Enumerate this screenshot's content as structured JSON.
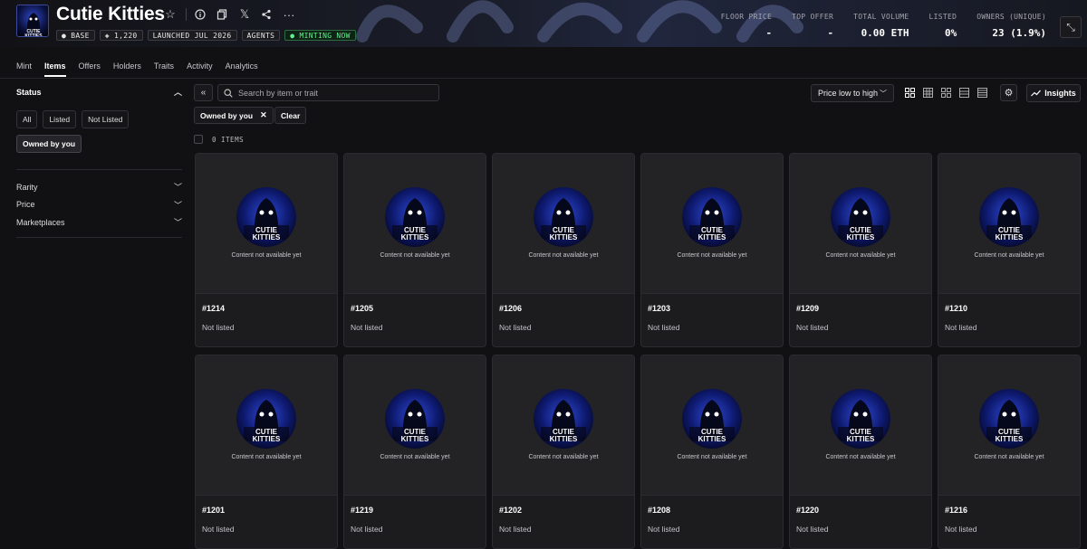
{
  "collection": {
    "name": "Cutie Kitties",
    "logo_text": "CUTIE KITTIES",
    "badges": [
      {
        "label": "BASE",
        "icon": "base-chain-icon"
      },
      {
        "label": "1,220",
        "icon": "items-icon"
      },
      {
        "label": "LAUNCHED JUL 2026"
      },
      {
        "label": "AGENTS"
      },
      {
        "label": "MINTING NOW",
        "color": "#5ef08b"
      }
    ]
  },
  "header_icons": [
    "star-icon",
    "info-icon",
    "copy-icon",
    "x-logo-icon",
    "share-icon",
    "more-icon"
  ],
  "stats": [
    {
      "label": "FLOOR PRICE",
      "value": "-"
    },
    {
      "label": "TOP OFFER",
      "value": "-"
    },
    {
      "label": "TOTAL VOLUME",
      "value": "0.00 ETH"
    },
    {
      "label": "LISTED",
      "value": "0%"
    },
    {
      "label": "OWNERS (UNIQUE)",
      "value": "23 (1.9%)"
    }
  ],
  "tabs": [
    {
      "label": "Mint",
      "active": false
    },
    {
      "label": "Items",
      "active": true
    },
    {
      "label": "Offers",
      "active": false
    },
    {
      "label": "Holders",
      "active": false
    },
    {
      "label": "Traits",
      "active": false
    },
    {
      "label": "Activity",
      "active": false
    },
    {
      "label": "Analytics",
      "active": false
    }
  ],
  "sidebar": {
    "status_title": "Status",
    "status_options": [
      "All",
      "Listed",
      "Not Listed"
    ],
    "owned_label": "Owned by you",
    "sections": [
      "Rarity",
      "Price",
      "Marketplaces"
    ]
  },
  "toolbar": {
    "search_placeholder": "Search by item or trait",
    "sort_label": "Price low to high",
    "insights_label": "Insights",
    "filter_chip": "Owned by you",
    "clear_label": "Clear",
    "items_count": "0 ITEMS"
  },
  "cards": [
    {
      "name": "#1214",
      "status": "Not listed",
      "message": "Content not available yet"
    },
    {
      "name": "#1205",
      "status": "Not listed",
      "message": "Content not available yet"
    },
    {
      "name": "#1206",
      "status": "Not listed",
      "message": "Content not available yet"
    },
    {
      "name": "#1203",
      "status": "Not listed",
      "message": "Content not available yet"
    },
    {
      "name": "#1209",
      "status": "Not listed",
      "message": "Content not available yet"
    },
    {
      "name": "#1210",
      "status": "Not listed",
      "message": "Content not available yet"
    },
    {
      "name": "#1201",
      "status": "Not listed",
      "message": "Content not available yet"
    },
    {
      "name": "#1219",
      "status": "Not listed",
      "message": "Content not available yet"
    },
    {
      "name": "#1202",
      "status": "Not listed",
      "message": "Content not available yet"
    },
    {
      "name": "#1208",
      "status": "Not listed",
      "message": "Content not available yet"
    },
    {
      "name": "#1220",
      "status": "Not listed",
      "message": "Content not available yet"
    },
    {
      "name": "#1216",
      "status": "Not listed",
      "message": "Content not available yet"
    }
  ]
}
